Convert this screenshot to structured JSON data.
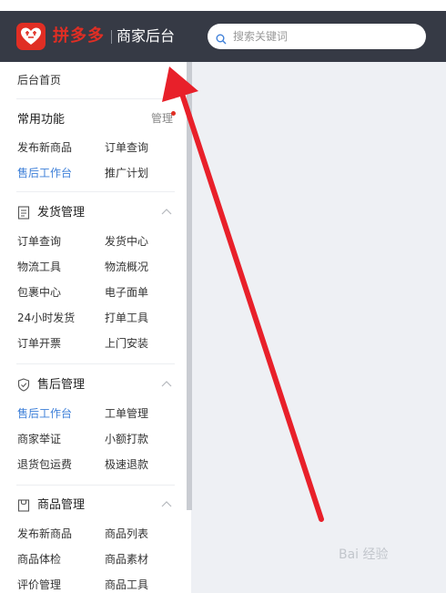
{
  "header": {
    "brand": "拼多多",
    "subbrand": "商家后台",
    "search_placeholder": "搜索关键词"
  },
  "sidebar": {
    "home": "后台首页",
    "common": {
      "title": "常用功能",
      "manage": "管理",
      "items": [
        "发布新商品",
        "订单查询",
        "售后工作台",
        "推广计划"
      ]
    },
    "shipping": {
      "title": "发货管理",
      "items": [
        "订单查询",
        "发货中心",
        "物流工具",
        "物流概况",
        "包裹中心",
        "电子面单",
        "24小时发货",
        "打单工具",
        "订单开票",
        "上门安装"
      ]
    },
    "aftersale": {
      "title": "售后管理",
      "items": [
        "售后工作台",
        "工单管理",
        "商家举证",
        "小额打款",
        "退货包运费",
        "极速退款"
      ]
    },
    "goods": {
      "title": "商品管理",
      "items": [
        "发布新商品",
        "商品列表",
        "商品体检",
        "商品素材",
        "评价管理",
        "商品工具"
      ]
    }
  },
  "colors": {
    "header_bg": "#363a45",
    "brand_red": "#e02e24",
    "active_blue": "#3d7fd8",
    "annotation_arrow": "#e8202a"
  },
  "watermark": "Bai 经验"
}
